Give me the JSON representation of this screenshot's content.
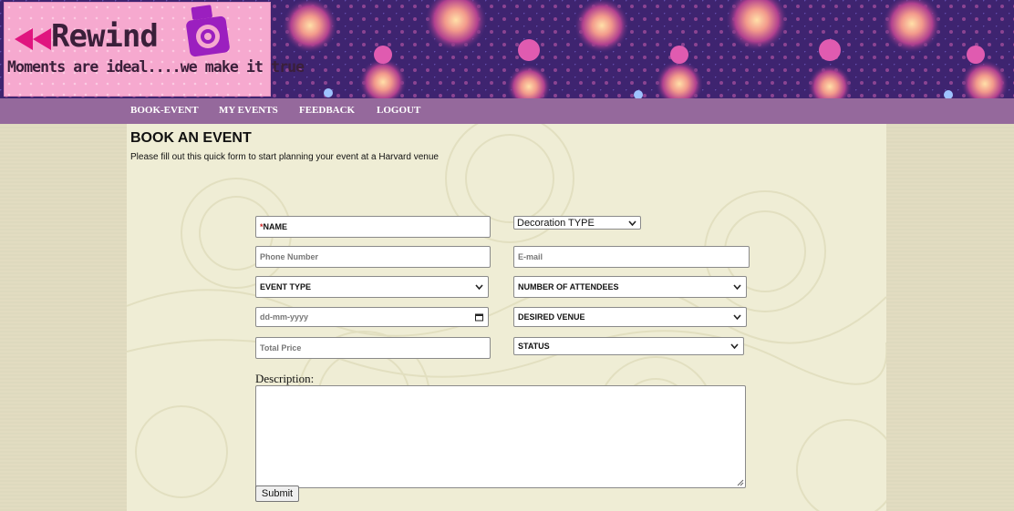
{
  "logo": {
    "title": "Rewind",
    "tagline": "Moments are ideal....we make it true"
  },
  "nav": {
    "items": [
      "BOOK-EVENT",
      "MY EVENTS",
      "FEEDBACK",
      "LOGOUT"
    ]
  },
  "page": {
    "title": "BOOK AN EVENT",
    "subtitle": "Please fill out this quick form to start planning your event at a Harvard venue"
  },
  "form": {
    "name_required_mark": "*",
    "name_label": "NAME",
    "decoration_type": "Decoration TYPE",
    "phone_placeholder": "Phone Number",
    "email_placeholder": "E-mail",
    "event_type": "EVENT TYPE",
    "attendees": "NUMBER OF ATTENDEES",
    "date_placeholder": "dd-mm-yyyy",
    "venue": "DESIRED VENUE",
    "price_placeholder": "Total Price",
    "status": "STATUS",
    "description_label": "Description:",
    "submit_label": "Submit"
  },
  "colors": {
    "nav_bg": "#95699c",
    "logo_bg": "#f6a9cf",
    "banner_bg": "#4a2a78",
    "page_bg": "#efedd5"
  }
}
